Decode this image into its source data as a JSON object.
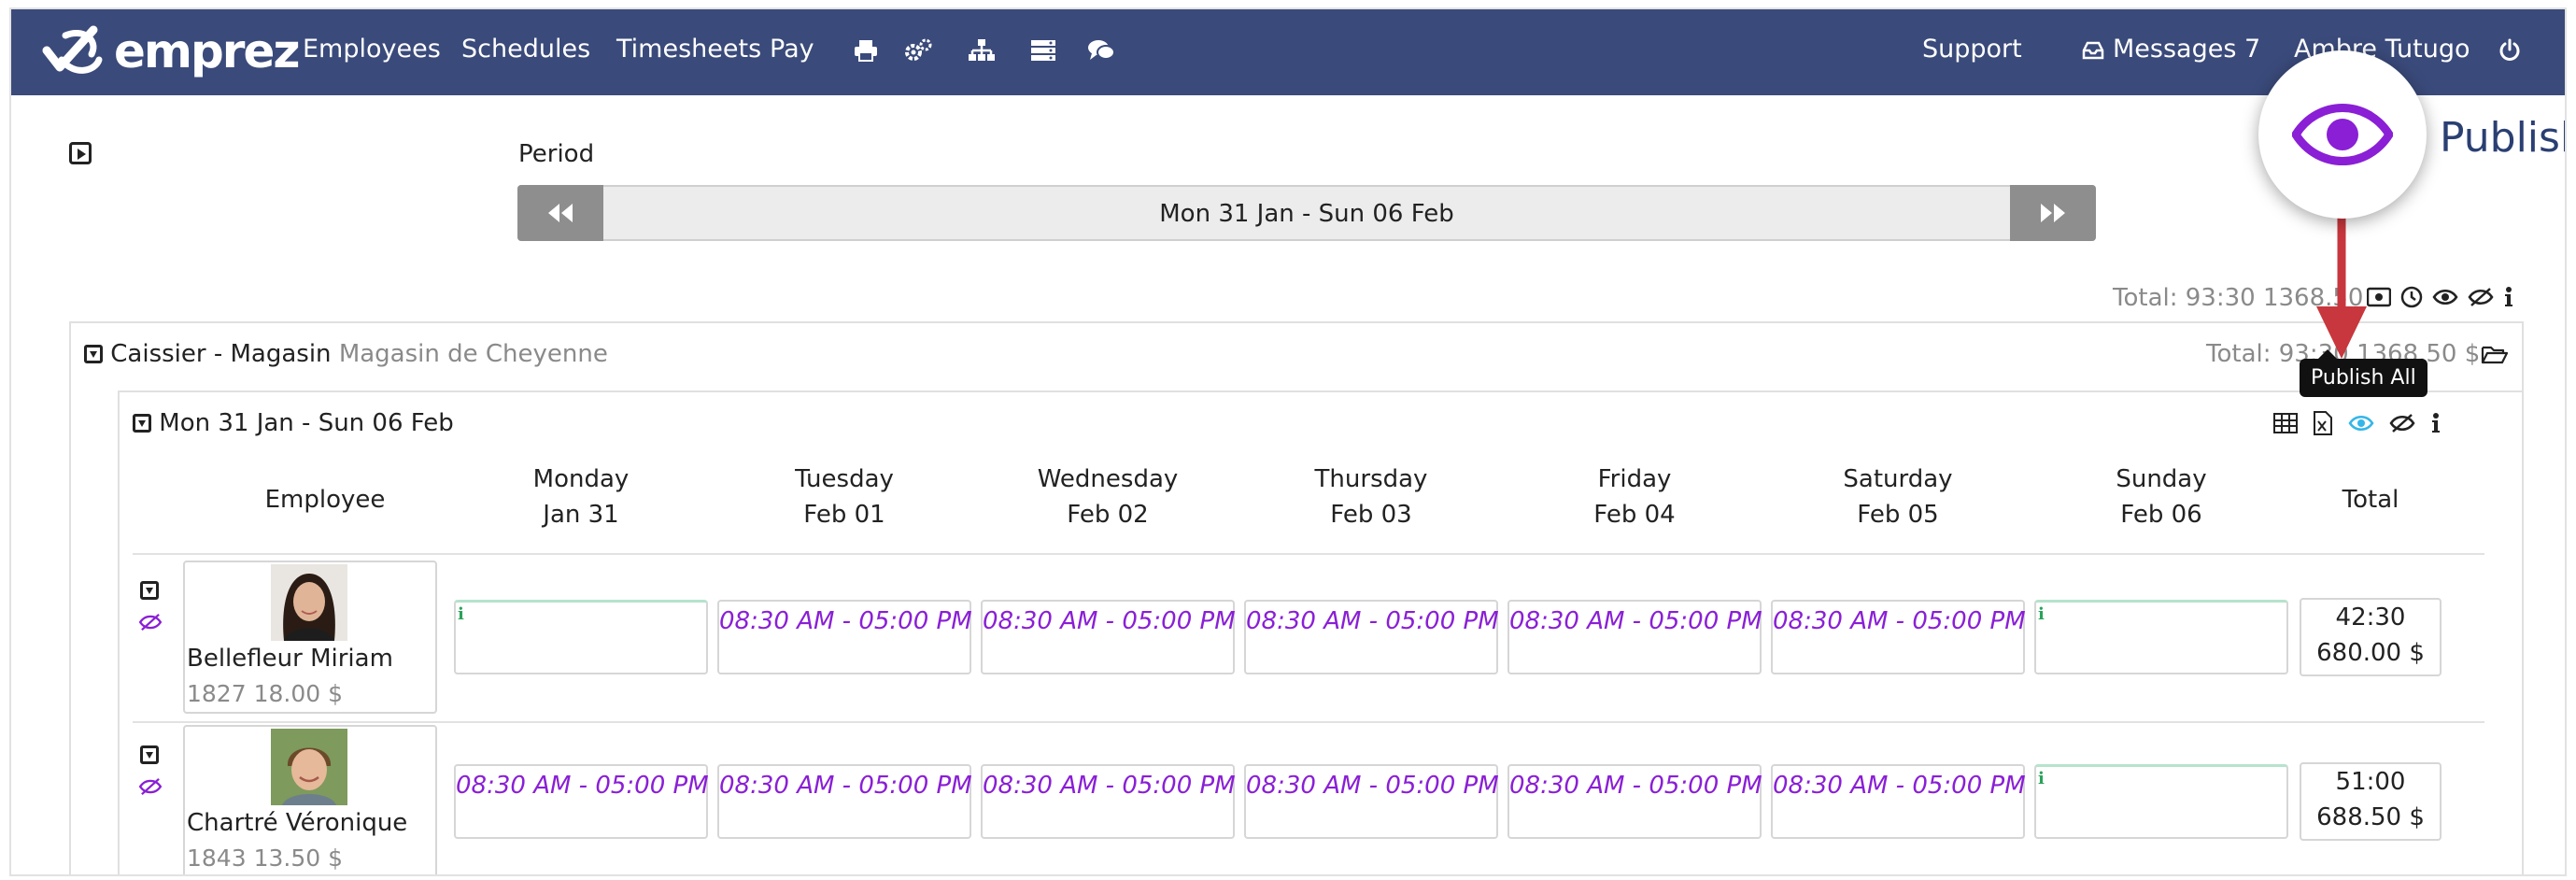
{
  "nav": {
    "brand": "emprez",
    "items": [
      "Employees",
      "Schedules",
      "Timesheets",
      "Pay"
    ],
    "icons": [
      "print-icon",
      "cogs-icon",
      "sitemap-icon",
      "server-icon",
      "comments-icon"
    ],
    "support": "Support",
    "messages": "Messages 7",
    "user": "Ambre Tutugo",
    "power_icon": "power-icon"
  },
  "period": {
    "label": "Period",
    "range": "Mon 31 Jan - Sun 06 Feb"
  },
  "summary": {
    "total": "Total: 93:30 1368.50"
  },
  "group": {
    "title": "Caissier - Magasin",
    "location": "Magasin de Cheyenne",
    "total": "Total: 93:30 1368.50 $"
  },
  "week": {
    "title": "Mon 31 Jan - Sun 06 Feb",
    "header_employee": "Employee",
    "header_total": "Total",
    "days": [
      {
        "day": "Monday",
        "date": "Jan 31"
      },
      {
        "day": "Tuesday",
        "date": "Feb 01"
      },
      {
        "day": "Wednesday",
        "date": "Feb 02"
      },
      {
        "day": "Thursday",
        "date": "Feb 03"
      },
      {
        "day": "Friday",
        "date": "Feb 04"
      },
      {
        "day": "Saturday",
        "date": "Feb 05"
      },
      {
        "day": "Sunday",
        "date": "Feb 06"
      }
    ],
    "employees": [
      {
        "name": "Bellefleur Miriam",
        "meta": "1827 18.00 $",
        "shifts": [
          "",
          "08:30 AM - 05:00 PM",
          "08:30 AM - 05:00 PM",
          "08:30 AM - 05:00 PM",
          "08:30 AM - 05:00 PM",
          "08:30 AM - 05:00 PM",
          ""
        ],
        "hours": "42:30",
        "amount": "680.00 $"
      },
      {
        "name": "Chartré Véronique",
        "meta": "1843 13.50 $",
        "shifts": [
          "08:30 AM - 05:00 PM",
          "08:30 AM - 05:00 PM",
          "08:30 AM - 05:00 PM",
          "08:30 AM - 05:00 PM",
          "08:30 AM - 05:00 PM",
          "08:30 AM - 05:00 PM",
          ""
        ],
        "hours": "51:00",
        "amount": "688.50 $"
      }
    ],
    "info_mark": "i"
  },
  "tooltip": "Publish All",
  "callout": {
    "label": "Publish",
    "icon": "eye-icon"
  },
  "colors": {
    "navbar": "#3a4a7a",
    "shift_text": "#8a1fd6",
    "publish_accent": "#8a1fd6",
    "arrow": "#c8373d"
  }
}
